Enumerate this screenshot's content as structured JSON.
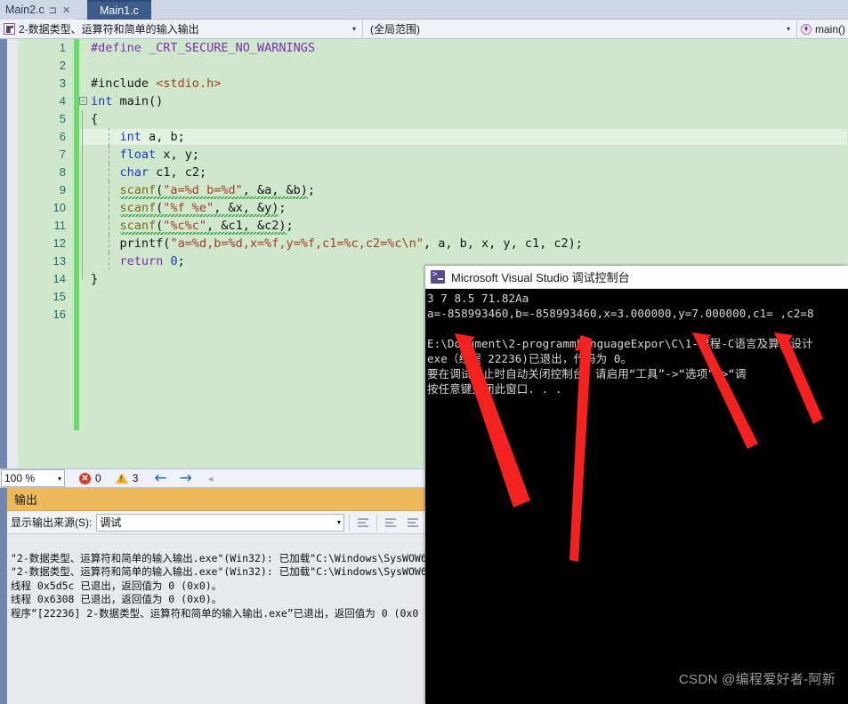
{
  "tabs": {
    "inactive_label": "Main2.c",
    "pin_icon": "pin-icon",
    "close_icon": "close-icon",
    "active_label": "Main1.c"
  },
  "navbar": {
    "project_label": "2-数据类型、运算符和简单的输入输出",
    "project_icon": "project-icon",
    "scope_label": "(全局范围)",
    "member_label": "main()",
    "member_icon": "method-icon",
    "dropdown_arrow": "▾"
  },
  "editor": {
    "line_numbers": [
      "1",
      "2",
      "3",
      "4",
      "5",
      "6",
      "7",
      "8",
      "9",
      "10",
      "11",
      "12",
      "13",
      "14",
      "15",
      "16"
    ],
    "lines": [
      "#define _CRT_SECURE_NO_WARNINGS",
      "",
      "#include <stdio.h>",
      "int main()",
      "{",
      "    int a, b;",
      "    float x, y;",
      "    char c1, c2;",
      "    scanf(\"a=%d b=%d\", &a, &b);",
      "    scanf(\"%f %e\", &x, &y);",
      "    scanf(\"%c%c\", &c1, &c2);",
      "    printf(\"a=%d,b=%d,x=%f,y=%f,c1=%c,c2=%c\\n\", a, b, x, y, c1, c2);",
      "    return 0;",
      "}",
      "",
      ""
    ],
    "fold_glyph": "−",
    "current_line": 6
  },
  "status": {
    "zoom_value": "100 %",
    "zoom_arrow": "▾",
    "error_count": "0",
    "warning_count": "3",
    "error_icon": "error-icon",
    "warning_icon": "warning-icon",
    "back_arrow": "←",
    "forward_arrow": "→",
    "extra_arrow": "◂"
  },
  "output": {
    "title": "输出",
    "source_label": "显示输出来源(S):",
    "source_value": "调试",
    "source_arrow": "▾",
    "lines": [
      "\"2-数据类型、运算符和简单的输入输出.exe\"(Win32): 已加载\"C:\\Windows\\SysWOW6",
      "\"2-数据类型、运算符和简单的输入输出.exe\"(Win32): 已加载\"C:\\Windows\\SysWOW6",
      "线程 0x5d5c 已退出，返回值为 0 (0x0)。",
      "线程 0x6308 已退出，返回值为 0 (0x0)。",
      "程序“[22236] 2-数据类型、运算符和简单的输入输出.exe”已退出，返回值为 0 (0x0"
    ]
  },
  "console": {
    "title": "Microsoft Visual Studio 调试控制台",
    "icon": "console-icon",
    "lines": [
      "3 7 8.5 71.82Aa",
      "a=-858993460,b=-858993460,x=3.000000,y=7.000000,c1= ,c2=8",
      "",
      "E:\\Document\\2-programmLanguageExpor\\C\\1-课程-C语言及算法设计",
      "exe（线程 22236)已退出，代码为 0。",
      "要在调试停止时自动关闭控制台，请启用“工具”->“选项”->“调",
      "按任意键关闭此窗口. . ."
    ]
  },
  "watermark": "CSDN @编程爱好者-阿新",
  "annotations": {
    "arrow_color": "#f42121",
    "count": 4
  }
}
